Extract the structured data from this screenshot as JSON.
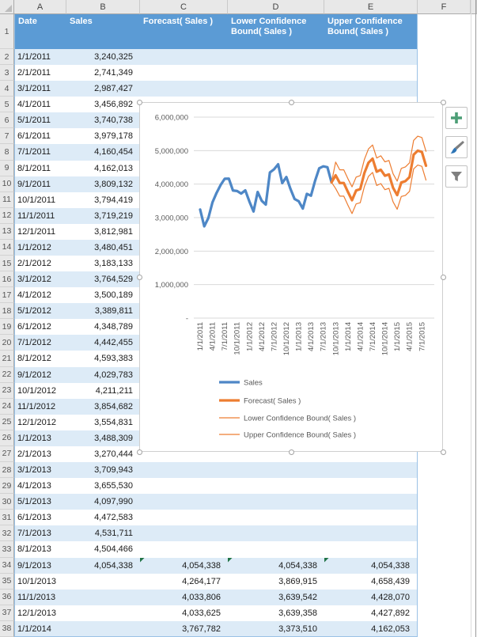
{
  "app": {
    "name": "Excel worksheet with forecast chart"
  },
  "colors": {
    "table_header_fill": "#5B9BD5",
    "band_fill": "#DDEBF7",
    "sales_line": "#4E87C6",
    "forecast_line": "#ED7D31",
    "gridline": "#D9D9D9",
    "tick_text": "#595959",
    "flag_green": "#217346",
    "plus_green": "#4C9E76"
  },
  "spreadsheet": {
    "column_headers": [
      "A",
      "B",
      "C",
      "D",
      "E"
    ],
    "last_column_header": "F",
    "header_row_number": "1",
    "table": {
      "headers": [
        "Date",
        "Sales",
        "Forecast( Sales )",
        "Lower Confidence Bound( Sales )",
        "Upper Confidence Bound( Sales )"
      ],
      "rows": [
        {
          "n": "2",
          "date": "1/1/2011",
          "sales": "3,240,325",
          "forecast": "",
          "lower": "",
          "upper": "",
          "flag": false
        },
        {
          "n": "3",
          "date": "2/1/2011",
          "sales": "2,741,349",
          "forecast": "",
          "lower": "",
          "upper": "",
          "flag": false
        },
        {
          "n": "4",
          "date": "3/1/2011",
          "sales": "2,987,427",
          "forecast": "",
          "lower": "",
          "upper": "",
          "flag": false
        },
        {
          "n": "5",
          "date": "4/1/2011",
          "sales": "3,456,892",
          "forecast": "",
          "lower": "",
          "upper": "",
          "flag": false
        },
        {
          "n": "6",
          "date": "5/1/2011",
          "sales": "3,740,738",
          "forecast": "",
          "lower": "",
          "upper": "",
          "flag": false
        },
        {
          "n": "7",
          "date": "6/1/2011",
          "sales": "3,979,178",
          "forecast": "",
          "lower": "",
          "upper": "",
          "flag": false
        },
        {
          "n": "8",
          "date": "7/1/2011",
          "sales": "4,160,454",
          "forecast": "",
          "lower": "",
          "upper": "",
          "flag": false
        },
        {
          "n": "9",
          "date": "8/1/2011",
          "sales": "4,162,013",
          "forecast": "",
          "lower": "",
          "upper": "",
          "flag": false
        },
        {
          "n": "10",
          "date": "9/1/2011",
          "sales": "3,809,132",
          "forecast": "",
          "lower": "",
          "upper": "",
          "flag": false
        },
        {
          "n": "11",
          "date": "10/1/2011",
          "sales": "3,794,419",
          "forecast": "",
          "lower": "",
          "upper": "",
          "flag": false
        },
        {
          "n": "12",
          "date": "11/1/2011",
          "sales": "3,719,219",
          "forecast": "",
          "lower": "",
          "upper": "",
          "flag": false
        },
        {
          "n": "13",
          "date": "12/1/2011",
          "sales": "3,812,981",
          "forecast": "",
          "lower": "",
          "upper": "",
          "flag": false
        },
        {
          "n": "14",
          "date": "1/1/2012",
          "sales": "3,480,451",
          "forecast": "",
          "lower": "",
          "upper": "",
          "flag": false
        },
        {
          "n": "15",
          "date": "2/1/2012",
          "sales": "3,183,133",
          "forecast": "",
          "lower": "",
          "upper": "",
          "flag": false
        },
        {
          "n": "16",
          "date": "3/1/2012",
          "sales": "3,764,529",
          "forecast": "",
          "lower": "",
          "upper": "",
          "flag": false
        },
        {
          "n": "17",
          "date": "4/1/2012",
          "sales": "3,500,189",
          "forecast": "",
          "lower": "",
          "upper": "",
          "flag": false
        },
        {
          "n": "18",
          "date": "5/1/2012",
          "sales": "3,389,811",
          "forecast": "",
          "lower": "",
          "upper": "",
          "flag": false
        },
        {
          "n": "19",
          "date": "6/1/2012",
          "sales": "4,348,789",
          "forecast": "",
          "lower": "",
          "upper": "",
          "flag": false
        },
        {
          "n": "20",
          "date": "7/1/2012",
          "sales": "4,442,455",
          "forecast": "",
          "lower": "",
          "upper": "",
          "flag": false
        },
        {
          "n": "21",
          "date": "8/1/2012",
          "sales": "4,593,383",
          "forecast": "",
          "lower": "",
          "upper": "",
          "flag": false
        },
        {
          "n": "22",
          "date": "9/1/2012",
          "sales": "4,029,783",
          "forecast": "",
          "lower": "",
          "upper": "",
          "flag": false
        },
        {
          "n": "23",
          "date": "10/1/2012",
          "sales": "4,211,211",
          "forecast": "",
          "lower": "",
          "upper": "",
          "flag": false
        },
        {
          "n": "24",
          "date": "11/1/2012",
          "sales": "3,854,682",
          "forecast": "",
          "lower": "",
          "upper": "",
          "flag": false
        },
        {
          "n": "25",
          "date": "12/1/2012",
          "sales": "3,554,831",
          "forecast": "",
          "lower": "",
          "upper": "",
          "flag": false
        },
        {
          "n": "26",
          "date": "1/1/2013",
          "sales": "3,488,309",
          "forecast": "",
          "lower": "",
          "upper": "",
          "flag": false
        },
        {
          "n": "27",
          "date": "2/1/2013",
          "sales": "3,270,444",
          "forecast": "",
          "lower": "",
          "upper": "",
          "flag": false
        },
        {
          "n": "28",
          "date": "3/1/2013",
          "sales": "3,709,943",
          "forecast": "",
          "lower": "",
          "upper": "",
          "flag": false
        },
        {
          "n": "29",
          "date": "4/1/2013",
          "sales": "3,655,530",
          "forecast": "",
          "lower": "",
          "upper": "",
          "flag": false
        },
        {
          "n": "30",
          "date": "5/1/2013",
          "sales": "4,097,990",
          "forecast": "",
          "lower": "",
          "upper": "",
          "flag": false
        },
        {
          "n": "31",
          "date": "6/1/2013",
          "sales": "4,472,583",
          "forecast": "",
          "lower": "",
          "upper": "",
          "flag": false
        },
        {
          "n": "32",
          "date": "7/1/2013",
          "sales": "4,531,711",
          "forecast": "",
          "lower": "",
          "upper": "",
          "flag": false
        },
        {
          "n": "33",
          "date": "8/1/2013",
          "sales": "4,504,466",
          "forecast": "",
          "lower": "",
          "upper": "",
          "flag": false
        },
        {
          "n": "34",
          "date": "9/1/2013",
          "sales": "4,054,338",
          "forecast": "4,054,338",
          "lower": "4,054,338",
          "upper": "4,054,338",
          "flag": true
        },
        {
          "n": "35",
          "date": "10/1/2013",
          "sales": "",
          "forecast": "4,264,177",
          "lower": "3,869,915",
          "upper": "4,658,439",
          "flag": false
        },
        {
          "n": "36",
          "date": "11/1/2013",
          "sales": "",
          "forecast": "4,033,806",
          "lower": "3,639,542",
          "upper": "4,428,070",
          "flag": false
        },
        {
          "n": "37",
          "date": "12/1/2013",
          "sales": "",
          "forecast": "4,033,625",
          "lower": "3,639,358",
          "upper": "4,427,892",
          "flag": false
        },
        {
          "n": "38",
          "date": "1/1/2014",
          "sales": "",
          "forecast": "3,767,782",
          "lower": "3,373,510",
          "upper": "4,162,053",
          "flag": false
        }
      ]
    }
  },
  "side_buttons": [
    {
      "id": "chart-elements-button",
      "icon": "plus-icon"
    },
    {
      "id": "chart-styles-button",
      "icon": "paintbrush-icon"
    },
    {
      "id": "chart-filters-button",
      "icon": "funnel-icon"
    }
  ],
  "chart_data": {
    "type": "line",
    "title": "",
    "interval": "monthly",
    "ylim": [
      0,
      6000000
    ],
    "y_tick_labels": [
      "-",
      "1,000,000",
      "2,000,000",
      "3,000,000",
      "4,000,000",
      "5,000,000",
      "6,000,000"
    ],
    "x_tick_labels": [
      "1/1/2011",
      "4/1/2011",
      "7/1/2011",
      "10/1/2011",
      "1/1/2012",
      "4/1/2012",
      "7/1/2012",
      "10/1/2012",
      "1/1/2013",
      "4/1/2013",
      "7/1/2013",
      "10/1/2013",
      "1/1/2014",
      "4/1/2014",
      "7/1/2014",
      "10/1/2014",
      "1/1/2015",
      "4/1/2015",
      "7/1/2015"
    ],
    "legend_position": "bottom-left",
    "grid": true,
    "series": [
      {
        "name": "Sales",
        "color": "#4E87C6",
        "line_width": 3.25,
        "start_date": "1/1/2011",
        "start_month_index": 0,
        "values": [
          3240325,
          2741349,
          2987427,
          3456892,
          3740738,
          3979178,
          4160454,
          4162013,
          3809132,
          3794419,
          3719219,
          3812981,
          3480451,
          3183133,
          3764529,
          3500189,
          3389811,
          4348789,
          4442455,
          4593383,
          4029783,
          4211211,
          3854682,
          3554831,
          3488309,
          3270444,
          3709943,
          3655530,
          4097990,
          4472583,
          4531711,
          4504466,
          4054338
        ]
      },
      {
        "name": "Forecast( Sales )",
        "color": "#ED7D31",
        "line_width": 3.25,
        "start_date": "9/1/2013",
        "start_month_index": 32,
        "values": [
          4054338,
          4264177,
          4033806,
          4033625,
          3767782,
          3520000,
          3810000,
          3850000,
          4330000,
          4640000,
          4760000,
          4370000,
          4430000,
          4250000,
          4290000,
          3890000,
          3670000,
          4050000,
          4090000,
          4210000,
          4880000,
          5000000,
          4960000,
          4550000
        ]
      },
      {
        "name": "Lower Confidence Bound( Sales )",
        "color": "#ED7D31",
        "line_width": 1.2,
        "start_date": "9/1/2013",
        "start_month_index": 32,
        "values": [
          4054338,
          3869915,
          3639542,
          3639358,
          3373510,
          3120000,
          3410000,
          3445000,
          3925000,
          4230000,
          4350000,
          3960000,
          4015000,
          3835000,
          3875000,
          3470000,
          3250000,
          3630000,
          3665000,
          3785000,
          4455000,
          4570000,
          4530000,
          4120000
        ]
      },
      {
        "name": "Upper Confidence Bound( Sales )",
        "color": "#ED7D31",
        "line_width": 1.2,
        "start_date": "9/1/2013",
        "start_month_index": 32,
        "values": [
          4054338,
          4658439,
          4428070,
          4427892,
          4162053,
          3920000,
          4210000,
          4255000,
          4735000,
          5050000,
          5170000,
          4780000,
          4845000,
          4665000,
          4705000,
          4310000,
          4090000,
          4470000,
          4515000,
          4635000,
          5305000,
          5430000,
          5390000,
          4980000
        ]
      }
    ]
  }
}
